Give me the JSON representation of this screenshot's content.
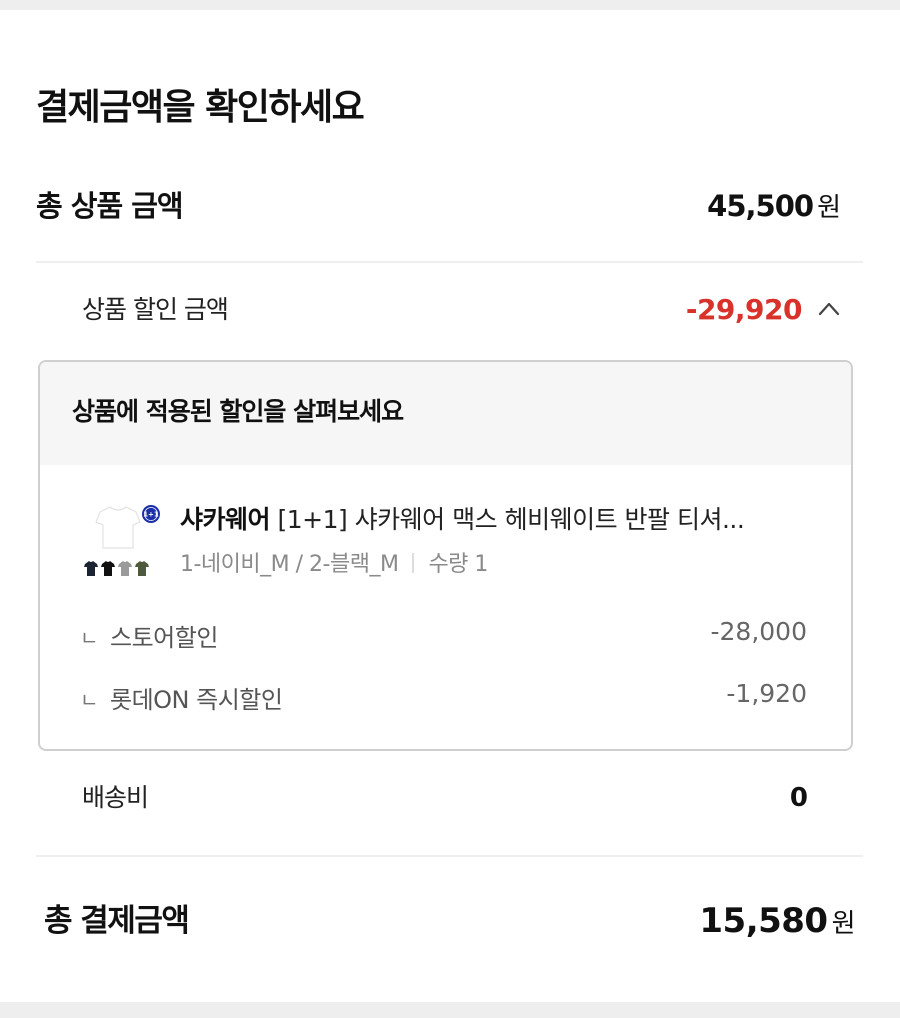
{
  "title": "결제금액을 확인하세요",
  "total_product": {
    "label": "총 상품 금액",
    "amount": "45,500",
    "unit": "원"
  },
  "product_discount": {
    "label": "상품 할인 금액",
    "amount": "-29,920",
    "icon": "chevron-up-icon"
  },
  "discount_panel": {
    "title": "상품에 적용된 할인을 살펴보세요",
    "product": {
      "thumbnail": "tshirt-product-image",
      "badge": "1+1",
      "brand": "샤카웨어",
      "name": "[1+1] 샤카웨어 맥스 헤비웨이트 반팔 티셔...",
      "options": "1-네이비_M / 2-블랙_M",
      "quantity": "수량 1"
    },
    "items": [
      {
        "mark": "ㄴ",
        "label": "스토어할인",
        "amount": "-28,000"
      },
      {
        "mark": "ㄴ",
        "label": "롯데ON 즉시할인",
        "amount": "-1,920"
      }
    ]
  },
  "shipping": {
    "label": "배송비",
    "amount": "0"
  },
  "total_payment": {
    "label": "총 결제금액",
    "amount": "15,580",
    "unit": "원"
  },
  "colors": {
    "discount_red": "#d8322b",
    "panel_header_bg": "#f6f6f6",
    "panel_border": "#cfcfcf"
  }
}
